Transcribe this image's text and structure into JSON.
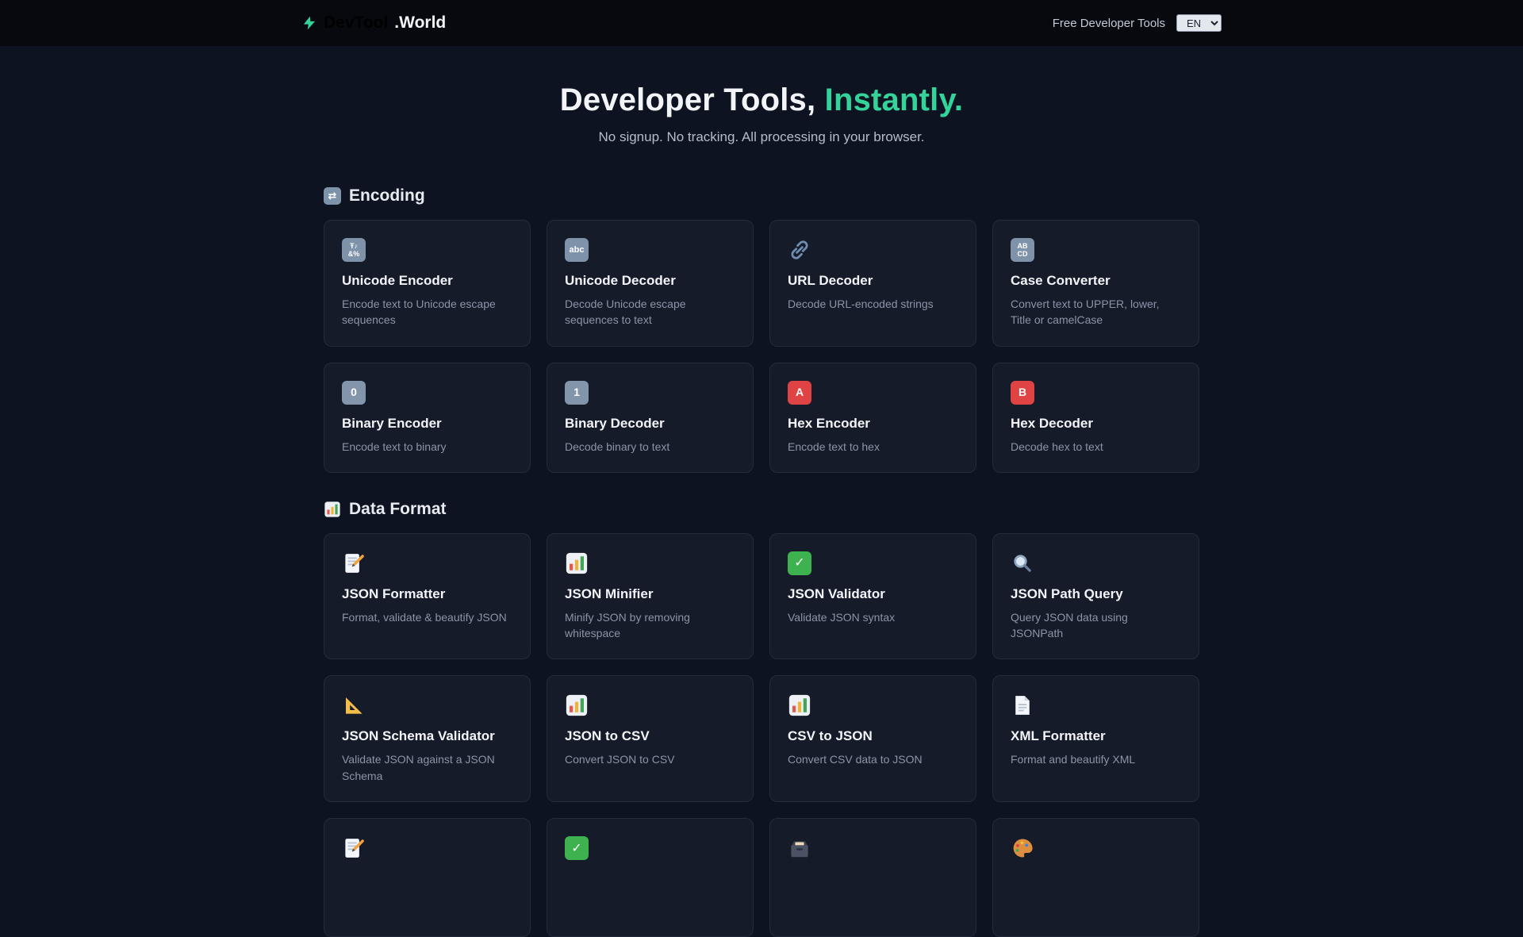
{
  "header": {
    "brand": {
      "name_primary": "DevTool",
      "name_secondary": ".World",
      "logo_icon": "lightning-bolt-icon"
    },
    "tagline": "Free Developer Tools",
    "language": {
      "selected": "EN",
      "options": [
        "EN"
      ]
    }
  },
  "hero": {
    "title_main": "Developer Tools,",
    "title_accent": "Instantly.",
    "subtitle": "No signup. No tracking. All processing in your browser."
  },
  "colors": {
    "accent": "#34d399",
    "background": "#0d1320",
    "header_background": "#07090f",
    "card_background": "#151b29"
  },
  "sections": [
    {
      "id": "encoding",
      "title": "Encoding",
      "icon": "arrows-cycle-icon",
      "tools": [
        {
          "label": "Unicode Encoder",
          "description": "Encode text to Unicode escape sequences",
          "icon": "input-symbols-icon"
        },
        {
          "label": "Unicode Decoder",
          "description": "Decode Unicode escape sequences to text",
          "icon": "abc-icon"
        },
        {
          "label": "URL Decoder",
          "description": "Decode URL-encoded strings",
          "icon": "link-icon"
        },
        {
          "label": "Case Converter",
          "description": "Convert text to UPPER, lower, Title or camelCase",
          "icon": "input-letters-icon"
        },
        {
          "label": "Binary Encoder",
          "description": "Encode text to binary",
          "icon": "keycap-zero-icon"
        },
        {
          "label": "Binary Decoder",
          "description": "Decode binary to text",
          "icon": "keycap-one-icon"
        },
        {
          "label": "Hex Encoder",
          "description": "Encode text to hex",
          "icon": "letter-a-icon"
        },
        {
          "label": "Hex Decoder",
          "description": "Decode hex to text",
          "icon": "letter-b-icon"
        }
      ]
    },
    {
      "id": "data-format",
      "title": "Data Format",
      "icon": "bar-chart-icon",
      "tools": [
        {
          "label": "JSON Formatter",
          "description": "Format, validate & beautify JSON",
          "icon": "memo-icon"
        },
        {
          "label": "JSON Minifier",
          "description": "Minify JSON by removing whitespace",
          "icon": "bar-chart-icon"
        },
        {
          "label": "JSON Validator",
          "description": "Validate JSON syntax",
          "icon": "check-mark-icon"
        },
        {
          "label": "JSON Path Query",
          "description": "Query JSON data using JSONPath",
          "icon": "magnifier-icon"
        },
        {
          "label": "JSON Schema Validator",
          "description": "Validate JSON against a JSON Schema",
          "icon": "triangle-ruler-icon"
        },
        {
          "label": "JSON to CSV",
          "description": "Convert JSON to CSV",
          "icon": "bar-chart-icon"
        },
        {
          "label": "CSV to JSON",
          "description": "Convert CSV data to JSON",
          "icon": "bar-chart-icon"
        },
        {
          "label": "XML Formatter",
          "description": "Format and beautify XML",
          "icon": "page-icon"
        },
        {
          "icon": "memo-icon"
        },
        {
          "icon": "check-mark-icon"
        },
        {
          "icon": "card-file-box-icon"
        },
        {
          "icon": "palette-icon"
        }
      ]
    }
  ]
}
